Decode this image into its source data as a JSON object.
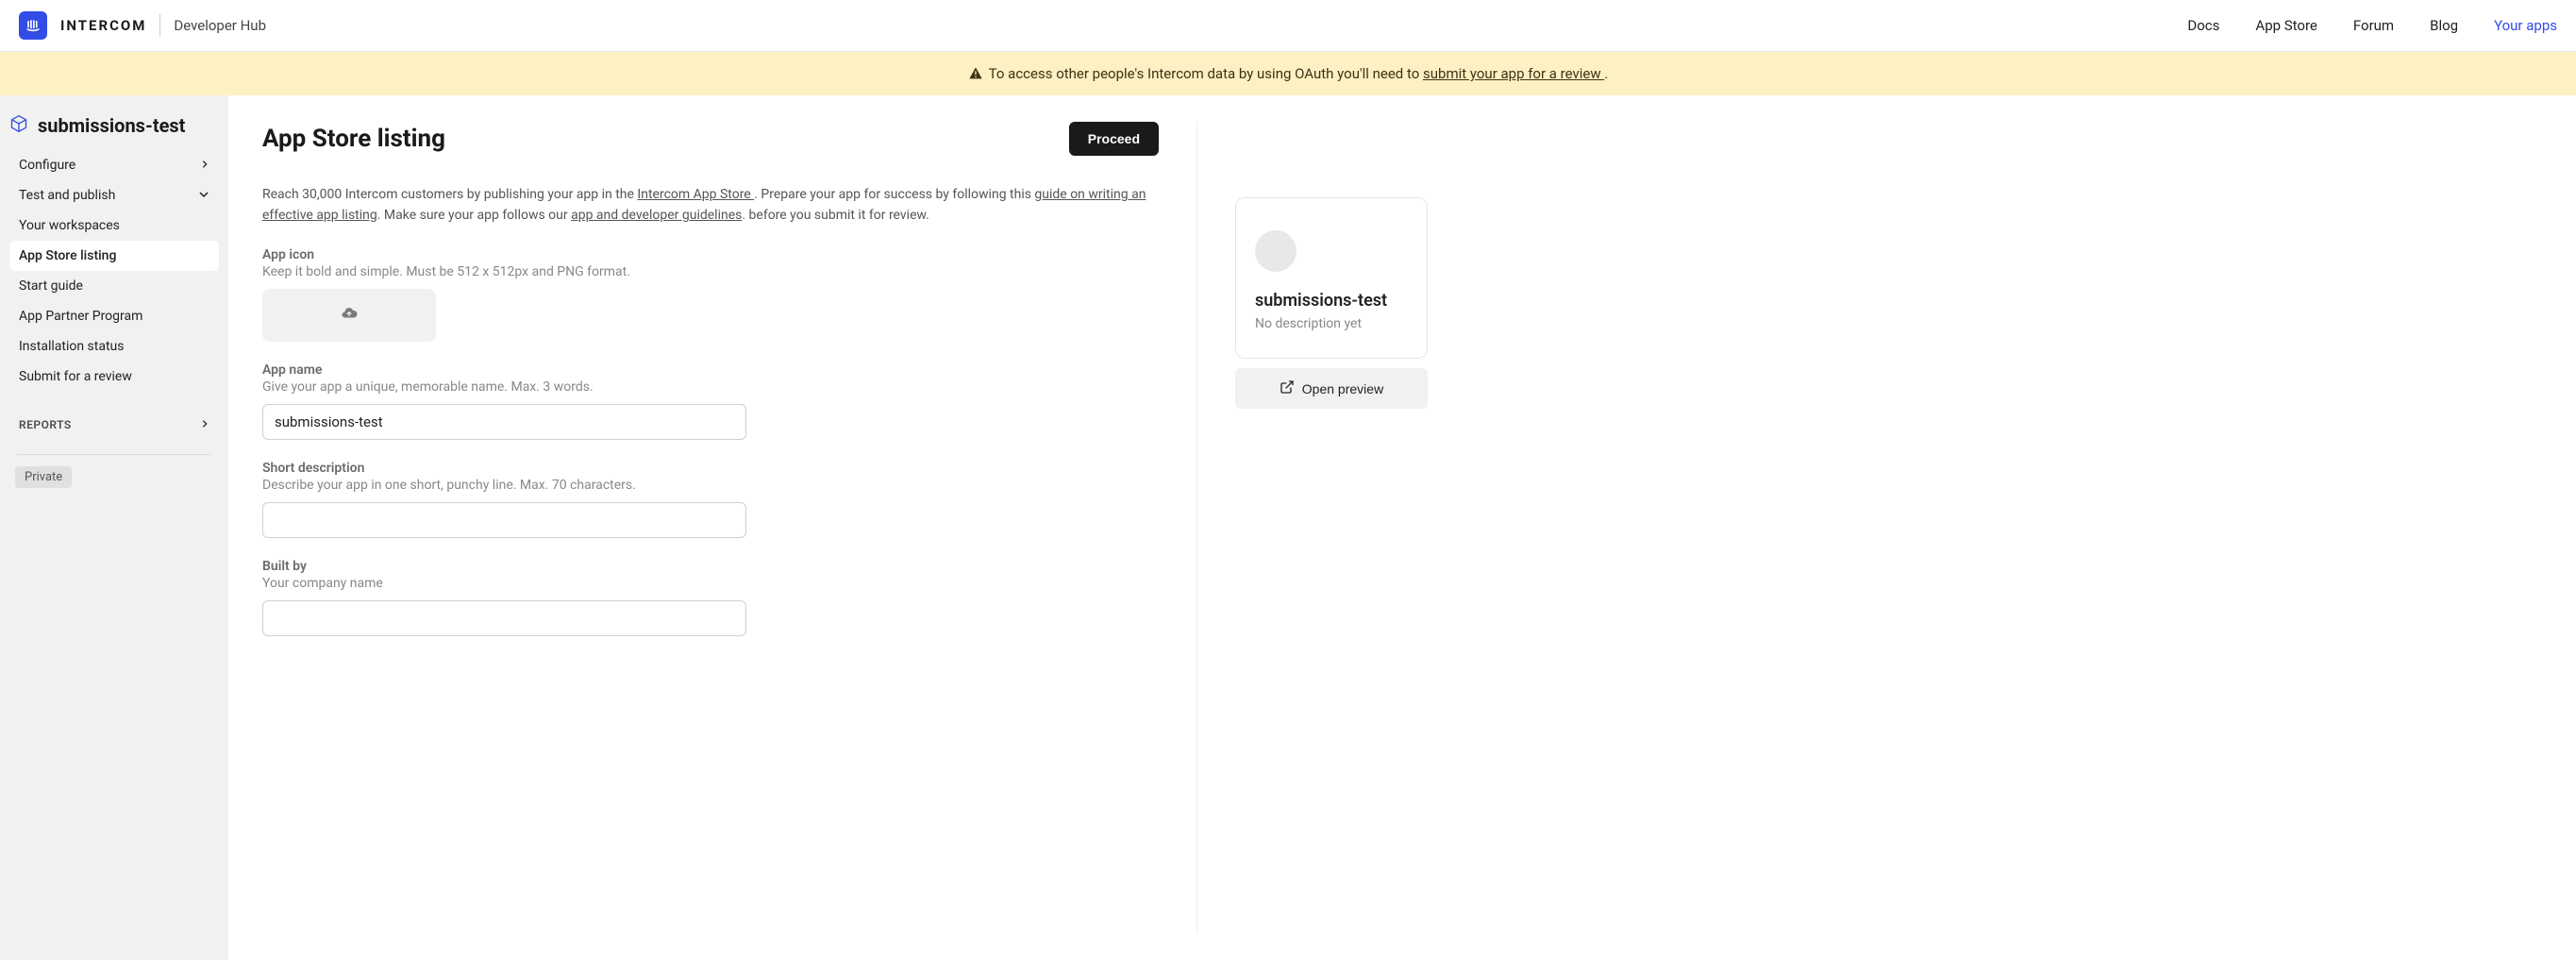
{
  "header": {
    "brand": "INTERCOM",
    "section": "Developer Hub",
    "nav": {
      "docs": "Docs",
      "app_store": "App Store",
      "forum": "Forum",
      "blog": "Blog",
      "your_apps": "Your apps"
    }
  },
  "banner": {
    "text_before": "To access other people's Intercom data by using OAuth you'll need to ",
    "link_text": "submit your app for a review ",
    "text_after": "."
  },
  "sidebar": {
    "app_name": "submissions-test",
    "items": {
      "configure": "Configure",
      "test_publish": "Test and publish",
      "workspaces": "Your workspaces",
      "listing": "App Store listing",
      "start_guide": "Start guide",
      "partner": "App Partner Program",
      "install_status": "Installation status",
      "submit_review": "Submit for a review"
    },
    "reports_label": "REPORTS",
    "private_badge": "Private"
  },
  "page": {
    "title": "App Store listing",
    "proceed_button": "Proceed",
    "intro": {
      "part1": "Reach 30,000 Intercom customers by publishing your app in the ",
      "link1": "Intercom App Store ",
      "part2": ". Prepare your app for success by following this ",
      "link2": "guide on writing an effective app listing",
      "part3": ". Make sure your app follows our ",
      "link3": "app and developer guidelines",
      "part4": ". before you submit it for review."
    },
    "fields": {
      "app_icon": {
        "label": "App icon",
        "help": "Keep it bold and simple. Must be 512 x 512px and PNG format."
      },
      "app_name": {
        "label": "App name",
        "help": "Give your app a unique, memorable name. Max. 3 words.",
        "value": "submissions-test"
      },
      "short_desc": {
        "label": "Short description",
        "help": "Describe your app in one short, punchy line. Max. 70 characters.",
        "value": ""
      },
      "built_by": {
        "label": "Built by",
        "help": "Your company name",
        "value": ""
      }
    }
  },
  "preview": {
    "name": "submissions-test",
    "description": "No description yet",
    "button": "Open preview"
  }
}
